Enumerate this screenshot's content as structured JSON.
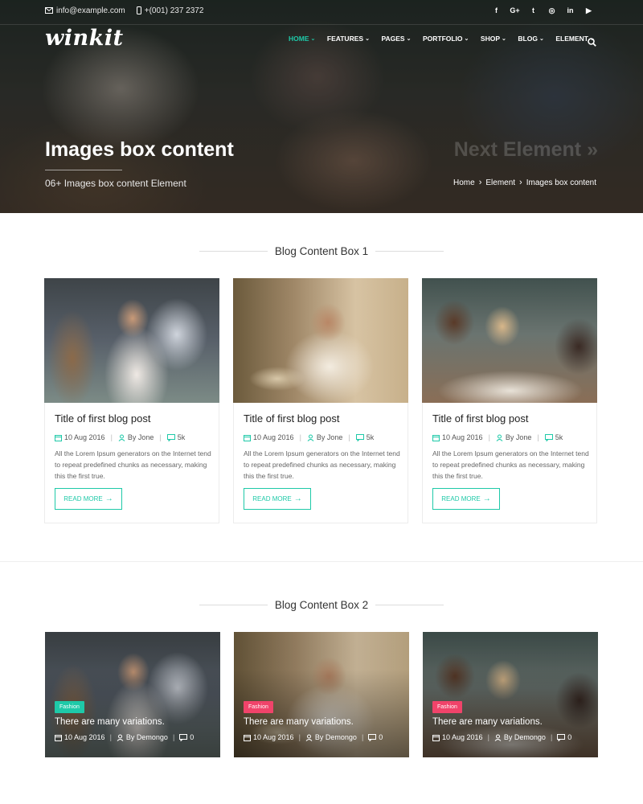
{
  "topbar": {
    "email": "info@example.com",
    "phone": "+(001) 237 2372",
    "socials": [
      {
        "icon": "facebook-icon",
        "glyph": "f"
      },
      {
        "icon": "google-plus-icon",
        "glyph": "G+"
      },
      {
        "icon": "twitter-icon",
        "glyph": "t"
      },
      {
        "icon": "instagram-icon",
        "glyph": "◎"
      },
      {
        "icon": "linkedin-icon",
        "glyph": "in"
      },
      {
        "icon": "youtube-icon",
        "glyph": "▶"
      }
    ]
  },
  "brand": {
    "logo_text": "winkit"
  },
  "nav": {
    "items": [
      {
        "label": "HOME",
        "active": true
      },
      {
        "label": "FEATURES",
        "active": false
      },
      {
        "label": "PAGES",
        "active": false
      },
      {
        "label": "PORTFOLIO",
        "active": false
      },
      {
        "label": "SHOP",
        "active": false
      },
      {
        "label": "BLOG",
        "active": false
      },
      {
        "label": "ELEMENT",
        "active": false
      }
    ],
    "search_icon": "search-icon"
  },
  "hero": {
    "title": "Images box content",
    "subtitle": "06+ Images box content Element",
    "next_label": "Next Element »",
    "breadcrumb": [
      "Home",
      "Element",
      "Images box content"
    ]
  },
  "section1": {
    "heading": "Blog Content Box 1",
    "cards": [
      {
        "title": "Title of first blog post",
        "date": "10 Aug 2016",
        "author": "By Jone",
        "comments": "5k",
        "excerpt": "All the Lorem Ipsum generators on the Internet tend to repeat predefined chunks as necessary, making this the first true.",
        "button": "READ MORE"
      },
      {
        "title": "Title of first blog post",
        "date": "10 Aug 2016",
        "author": "By Jone",
        "comments": "5k",
        "excerpt": "All the Lorem Ipsum generators on the Internet tend to repeat predefined chunks as necessary, making this the first true.",
        "button": "READ MORE"
      },
      {
        "title": "Title of first blog post",
        "date": "10 Aug 2016",
        "author": "By Jone",
        "comments": "5k",
        "excerpt": "All the Lorem Ipsum generators on the Internet tend to repeat predefined chunks as necessary, making this the first true.",
        "button": "READ MORE"
      }
    ]
  },
  "section2": {
    "heading": "Blog Content Box 2",
    "cards": [
      {
        "badge": "Fashion",
        "badge_color": "#1ec9a8",
        "title": "There are many variations.",
        "date": "10 Aug 2016",
        "author": "By Demongo",
        "comments": "0"
      },
      {
        "badge": "Fashion",
        "badge_color": "#f0436a",
        "title": "There are many variations.",
        "date": "10 Aug 2016",
        "author": "By Demongo",
        "comments": "0"
      },
      {
        "badge": "Fashion",
        "badge_color": "#f0436a",
        "title": "There are many variations.",
        "date": "10 Aug 2016",
        "author": "By Demongo",
        "comments": "0"
      }
    ]
  },
  "colors": {
    "accent": "#1ec9a8",
    "badge_pink": "#f0436a"
  }
}
